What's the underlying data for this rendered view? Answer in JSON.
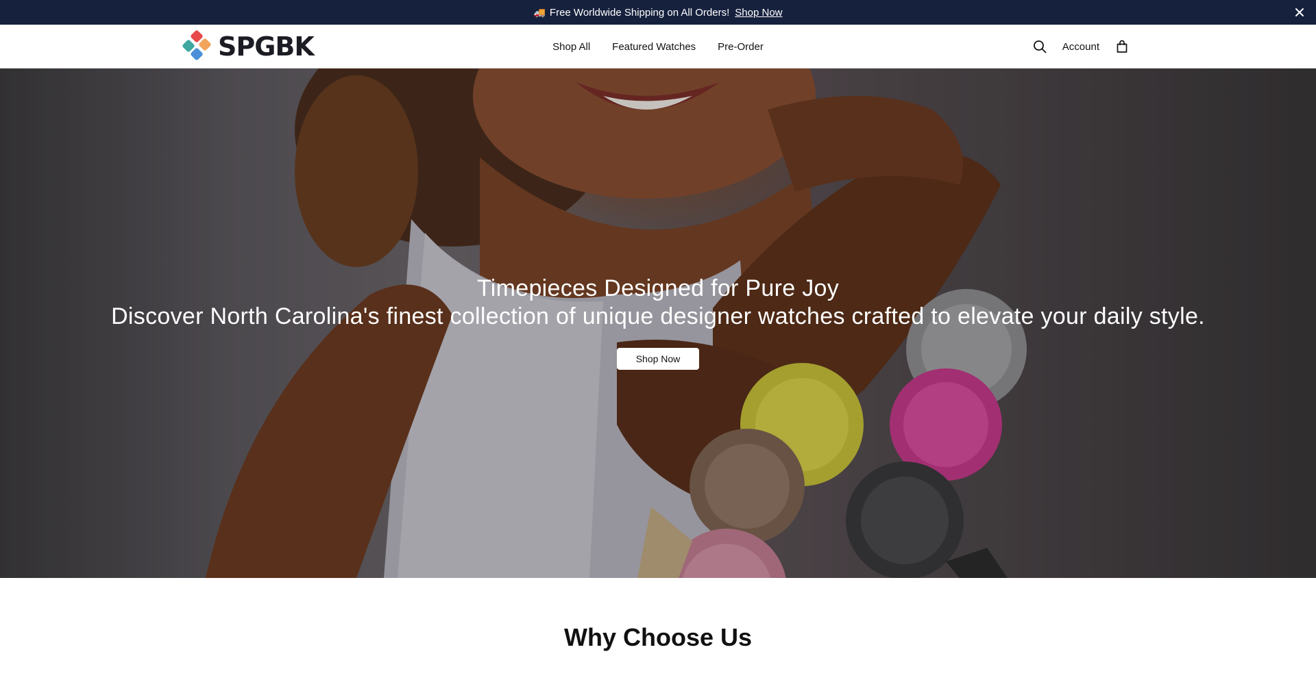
{
  "announcement": {
    "text": "Free Worldwide Shipping on All Orders!",
    "link_label": "Shop Now",
    "icon": "truck-icon",
    "close_icon": "close-icon"
  },
  "header": {
    "brand": "SPGBK",
    "nav": [
      "Shop All",
      "Featured Watches",
      "Pre-Order"
    ],
    "account_label": "Account",
    "icons": [
      "search-icon",
      "bag-icon"
    ]
  },
  "hero": {
    "title": "Timepieces Designed for Pure Joy",
    "subtitle": "Discover North Carolina's finest collection of unique designer watches crafted to elevate your daily style.",
    "cta_label": "Shop Now"
  },
  "section": {
    "heading": "Why Choose Us"
  },
  "colors": {
    "announcement_bg": "#16213e",
    "logo_red": "#e84a4a",
    "logo_orange": "#f2a45c",
    "logo_teal": "#3ea8a0",
    "logo_blue": "#4a8fd8"
  }
}
